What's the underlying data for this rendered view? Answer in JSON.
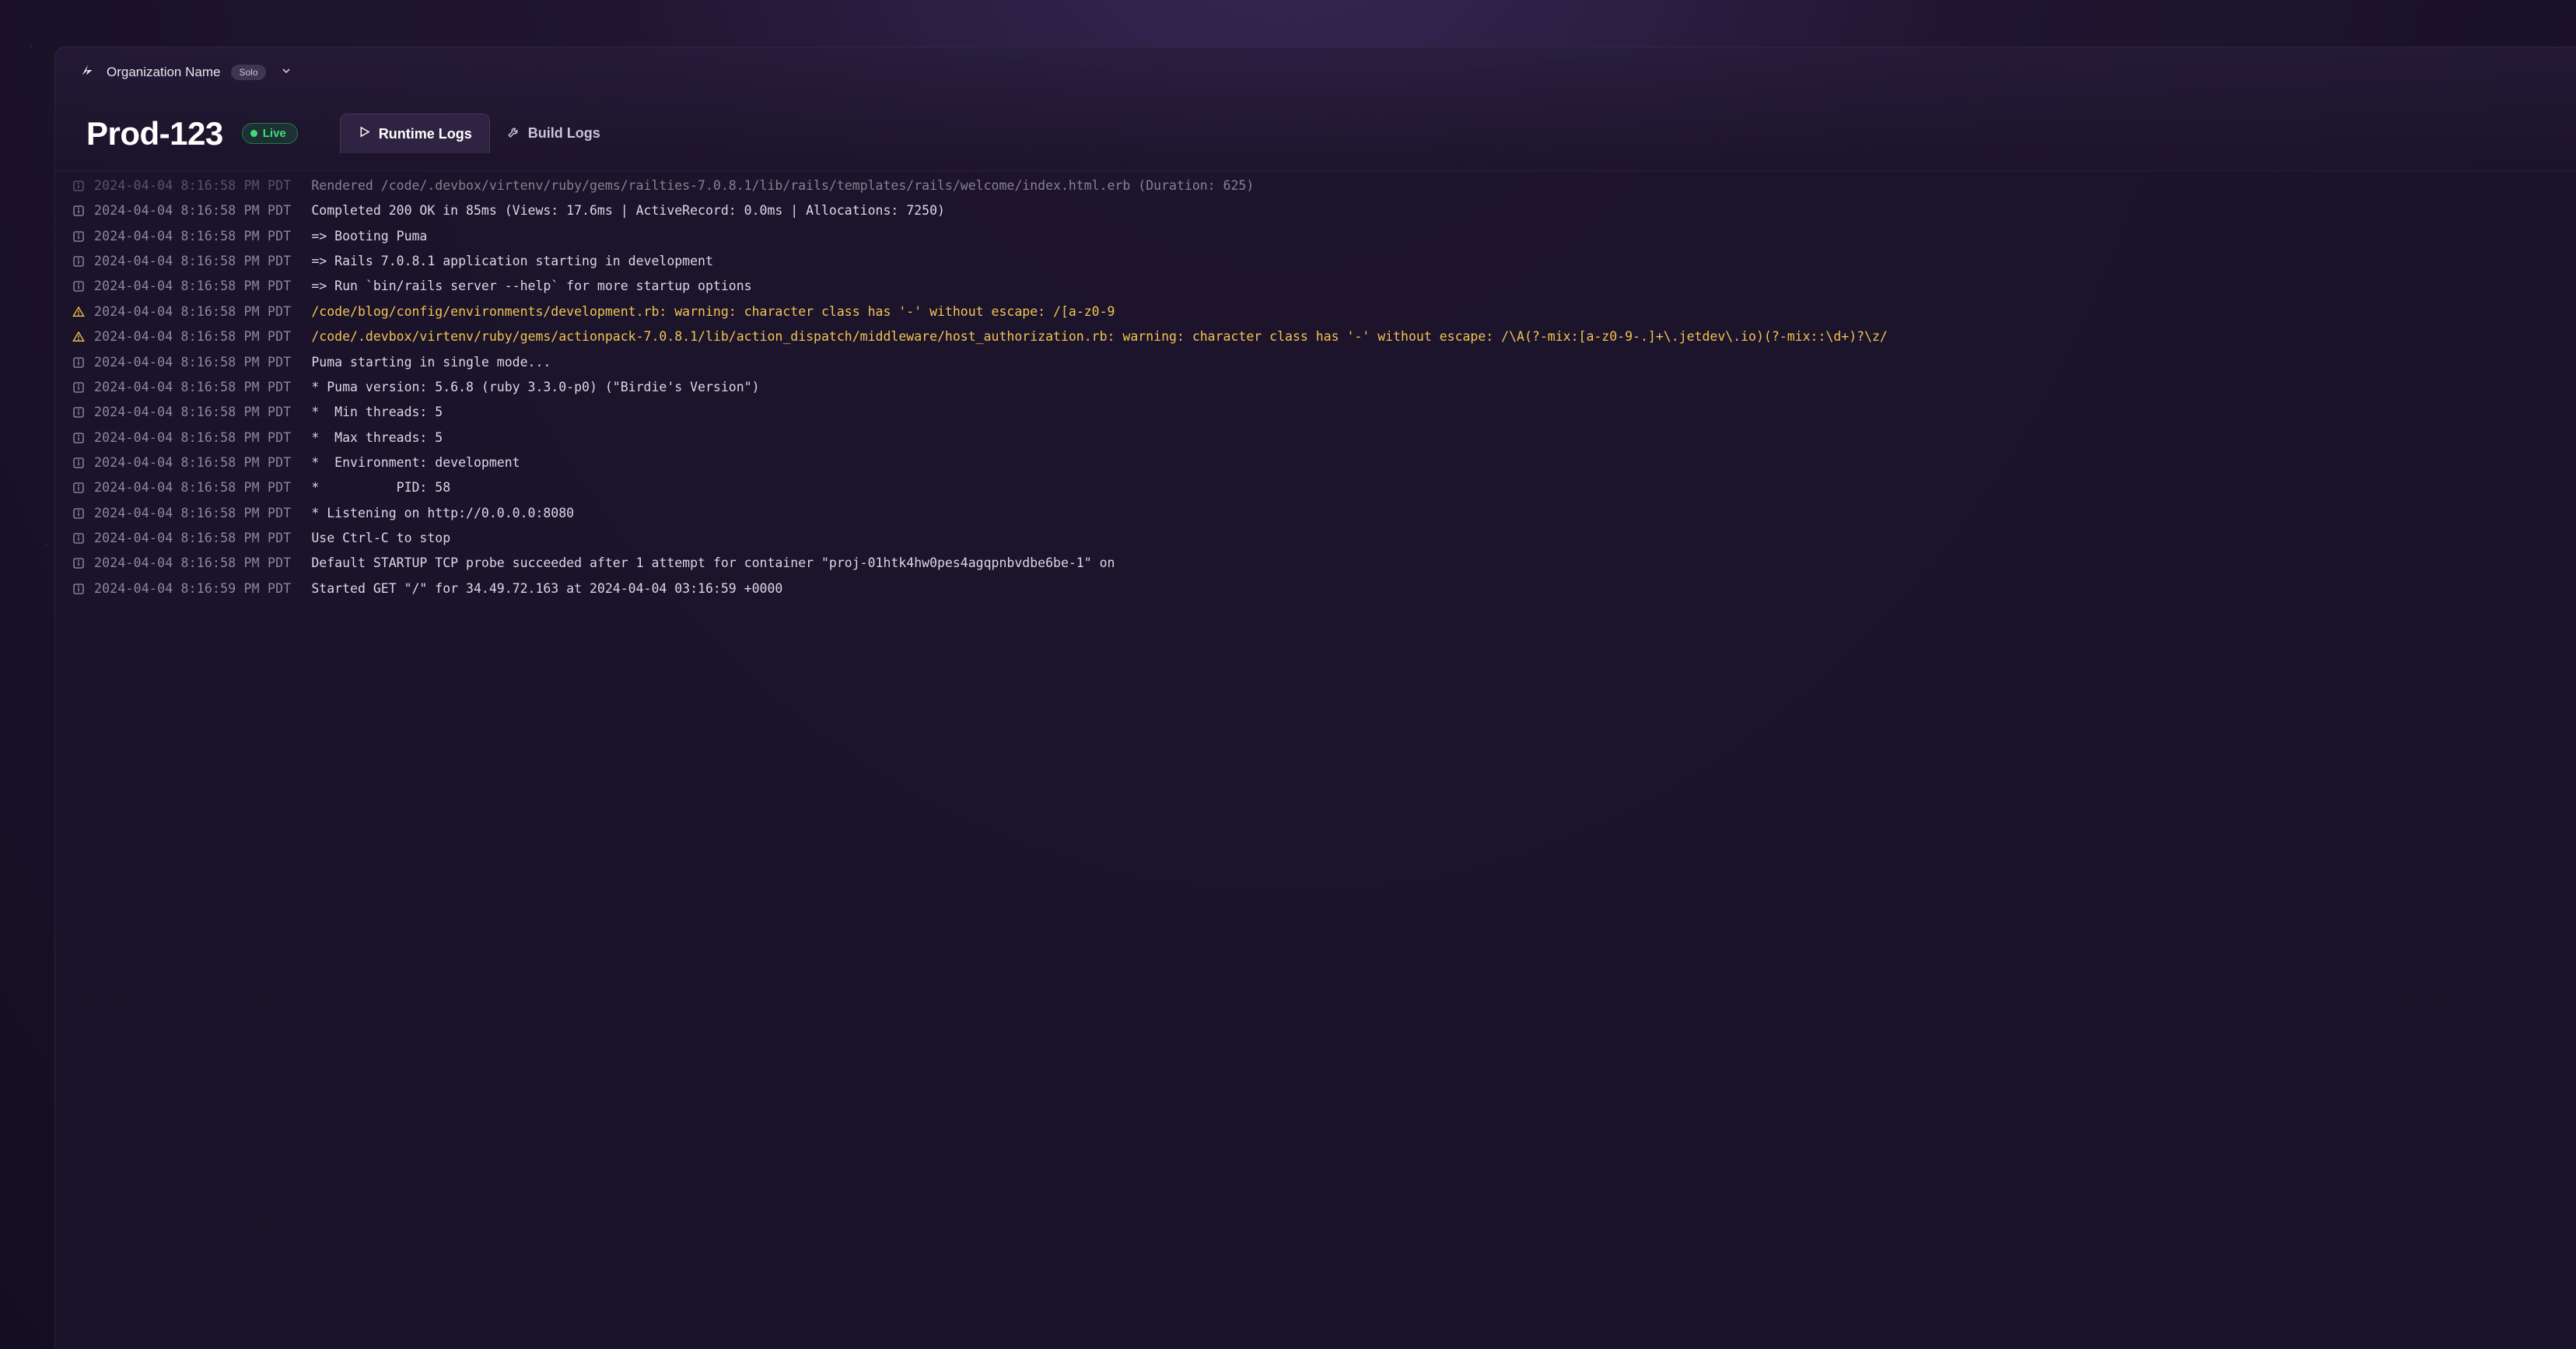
{
  "topbar": {
    "org_name": "Organization Name",
    "plan_badge": "Solo"
  },
  "header": {
    "page_title": "Prod-123",
    "status_label": "Live"
  },
  "tabs": {
    "runtime": "Runtime Logs",
    "build": "Build Logs"
  },
  "logs": [
    {
      "level": "info",
      "faded": true,
      "ts": "2024-04-04 8:16:58 PM PDT",
      "msg": "Rendered /code/.devbox/virtenv/ruby/gems/railties-7.0.8.1/lib/rails/templates/rails/welcome/index.html.erb (Duration: 625)"
    },
    {
      "level": "info",
      "ts": "2024-04-04 8:16:58 PM PDT",
      "msg": "Completed 200 OK in 85ms (Views: 17.6ms | ActiveRecord: 0.0ms | Allocations: 7250)"
    },
    {
      "level": "info",
      "ts": "2024-04-04 8:16:58 PM PDT",
      "msg": "=> Booting Puma"
    },
    {
      "level": "info",
      "ts": "2024-04-04 8:16:58 PM PDT",
      "msg": "=> Rails 7.0.8.1 application starting in development"
    },
    {
      "level": "info",
      "ts": "2024-04-04 8:16:58 PM PDT",
      "msg": "=> Run `bin/rails server --help` for more startup options"
    },
    {
      "level": "warn",
      "ts": "2024-04-04 8:16:58 PM PDT",
      "msg": "/code/blog/config/environments/development.rb: warning: character class has '-' without escape: /[a-z0-9"
    },
    {
      "level": "warn",
      "ts": "2024-04-04 8:16:58 PM PDT",
      "msg": "/code/.devbox/virtenv/ruby/gems/actionpack-7.0.8.1/lib/action_dispatch/middleware/host_authorization.rb: warning: character class has '-' without escape: /\\A(?-mix:[a-z0-9-.]+\\.jetdev\\.io)(?-mix::\\d+)?\\z/"
    },
    {
      "level": "info",
      "ts": "2024-04-04 8:16:58 PM PDT",
      "msg": "Puma starting in single mode..."
    },
    {
      "level": "info",
      "ts": "2024-04-04 8:16:58 PM PDT",
      "msg": "* Puma version: 5.6.8 (ruby 3.3.0-p0) (\"Birdie's Version\")"
    },
    {
      "level": "info",
      "ts": "2024-04-04 8:16:58 PM PDT",
      "msg": "*  Min threads: 5"
    },
    {
      "level": "info",
      "ts": "2024-04-04 8:16:58 PM PDT",
      "msg": "*  Max threads: 5"
    },
    {
      "level": "info",
      "ts": "2024-04-04 8:16:58 PM PDT",
      "msg": "*  Environment: development"
    },
    {
      "level": "info",
      "ts": "2024-04-04 8:16:58 PM PDT",
      "msg": "*          PID: 58"
    },
    {
      "level": "info",
      "ts": "2024-04-04 8:16:58 PM PDT",
      "msg": "* Listening on http://0.0.0.0:8080"
    },
    {
      "level": "info",
      "ts": "2024-04-04 8:16:58 PM PDT",
      "msg": "Use Ctrl-C to stop"
    },
    {
      "level": "info",
      "ts": "2024-04-04 8:16:58 PM PDT",
      "msg": "Default STARTUP TCP probe succeeded after 1 attempt for container \"proj-01htk4hw0pes4agqpnbvdbe6be-1\" on"
    },
    {
      "level": "info",
      "ts": "2024-04-04 8:16:59 PM PDT",
      "msg": "Started GET \"/\" for 34.49.72.163 at 2024-04-04 03:16:59 +0000"
    }
  ]
}
